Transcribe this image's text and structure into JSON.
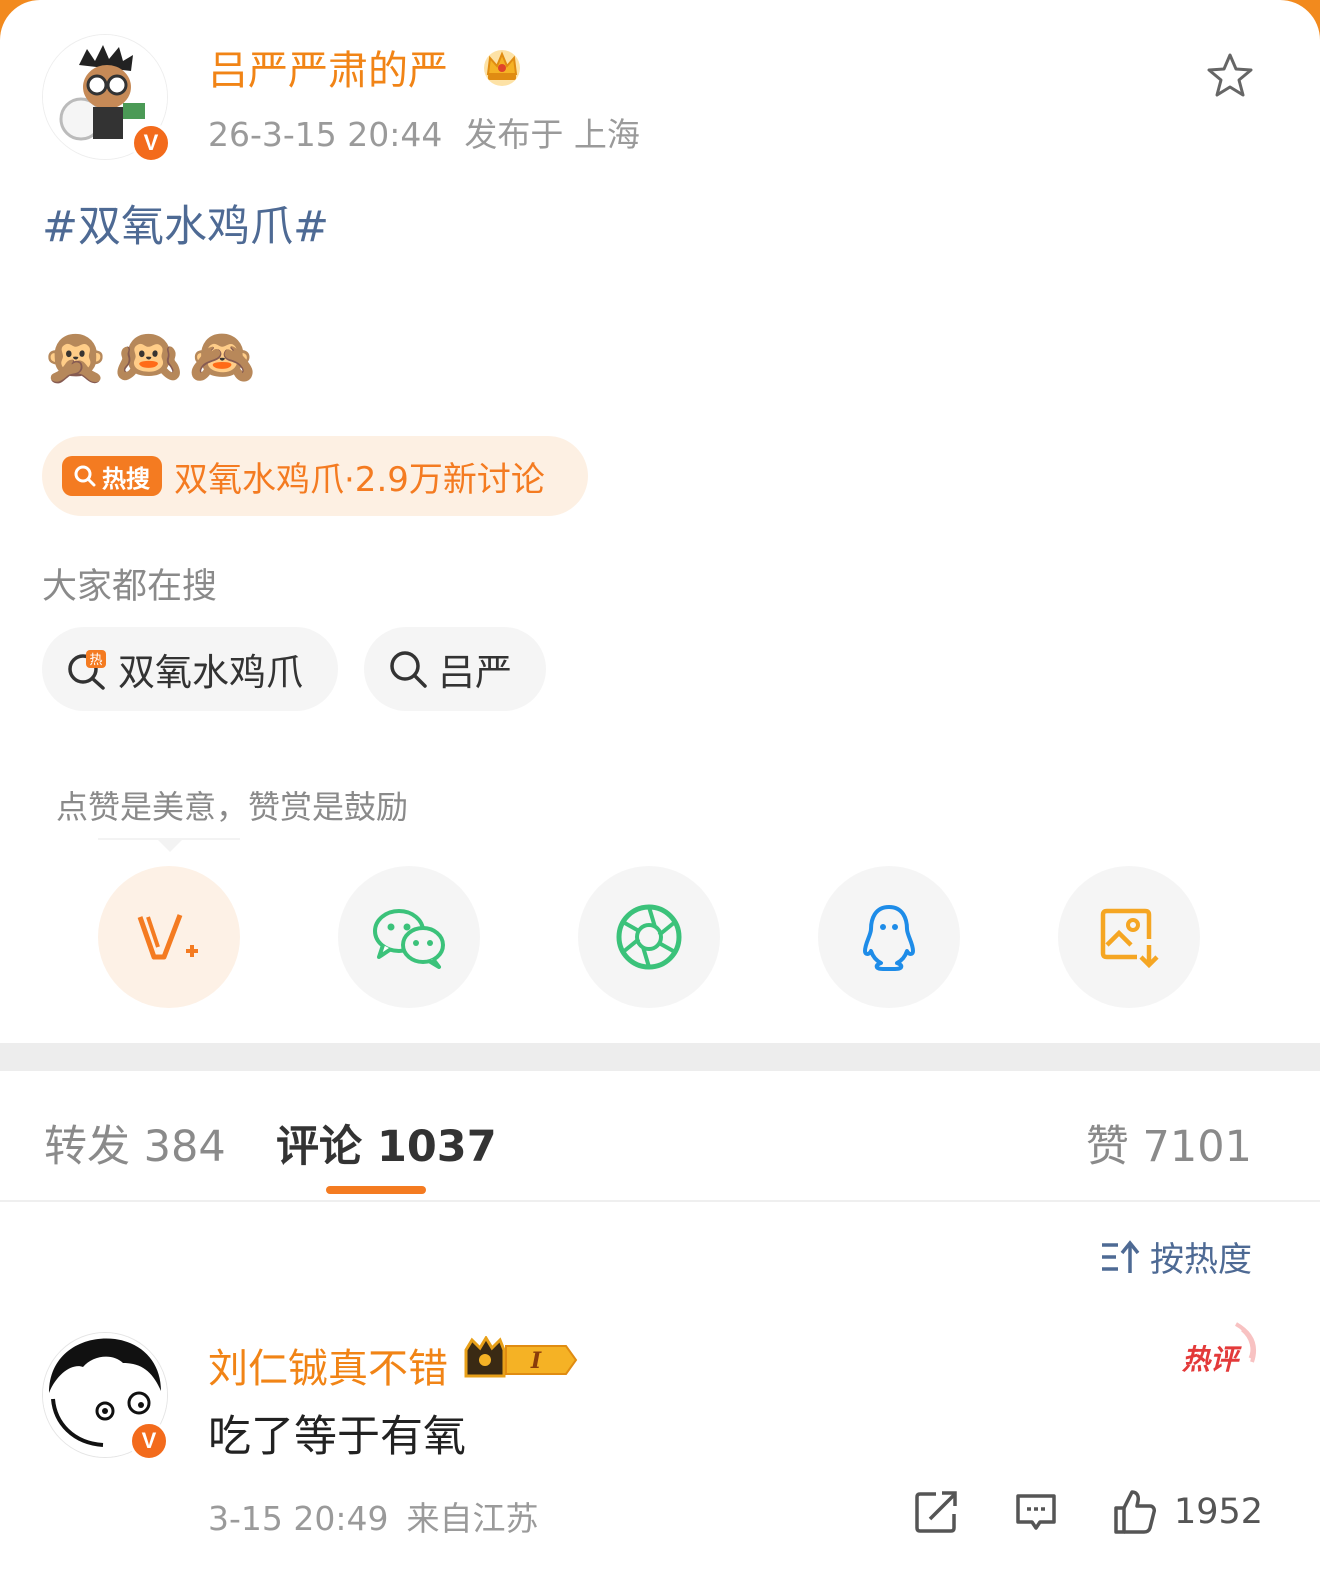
{
  "post": {
    "author": "吕严严肃的严",
    "verified_badge": "V",
    "date": "26-3-15 20:44",
    "location": "发布于 上海",
    "hashtag": "#双氧水鸡爪#",
    "emojis": "🙊🙉🙈",
    "hot_search": {
      "tag": "热搜",
      "text": "双氧水鸡爪·2.9万新讨论"
    }
  },
  "search": {
    "label": "大家都在搜",
    "chips": [
      {
        "text": "双氧水鸡爪",
        "icon": "hot-search-icon"
      },
      {
        "text": "吕严",
        "icon": "search-icon"
      }
    ]
  },
  "share": {
    "tip": "点赞是美意，赞赏是鼓励",
    "items": [
      "reward-v-plus-icon",
      "wechat-icon",
      "moments-icon",
      "qq-icon",
      "save-image-icon"
    ]
  },
  "tabs": {
    "repost": "转发 384",
    "comments": "评论 1037",
    "likes": "赞 7101"
  },
  "sort": {
    "label": "按热度"
  },
  "comment": {
    "user": "刘仁铖真不错",
    "level": "I",
    "hot_badge": "热评",
    "text": "吃了等于有氧",
    "date": "3-15 20:49",
    "location": "来自江苏",
    "like_count": "1952"
  },
  "colors": {
    "accent": "#f47b21",
    "link": "#4e6a94",
    "wechat": "#3bc27a",
    "moments": "#3bc27a",
    "qq": "#1e8ce8"
  }
}
